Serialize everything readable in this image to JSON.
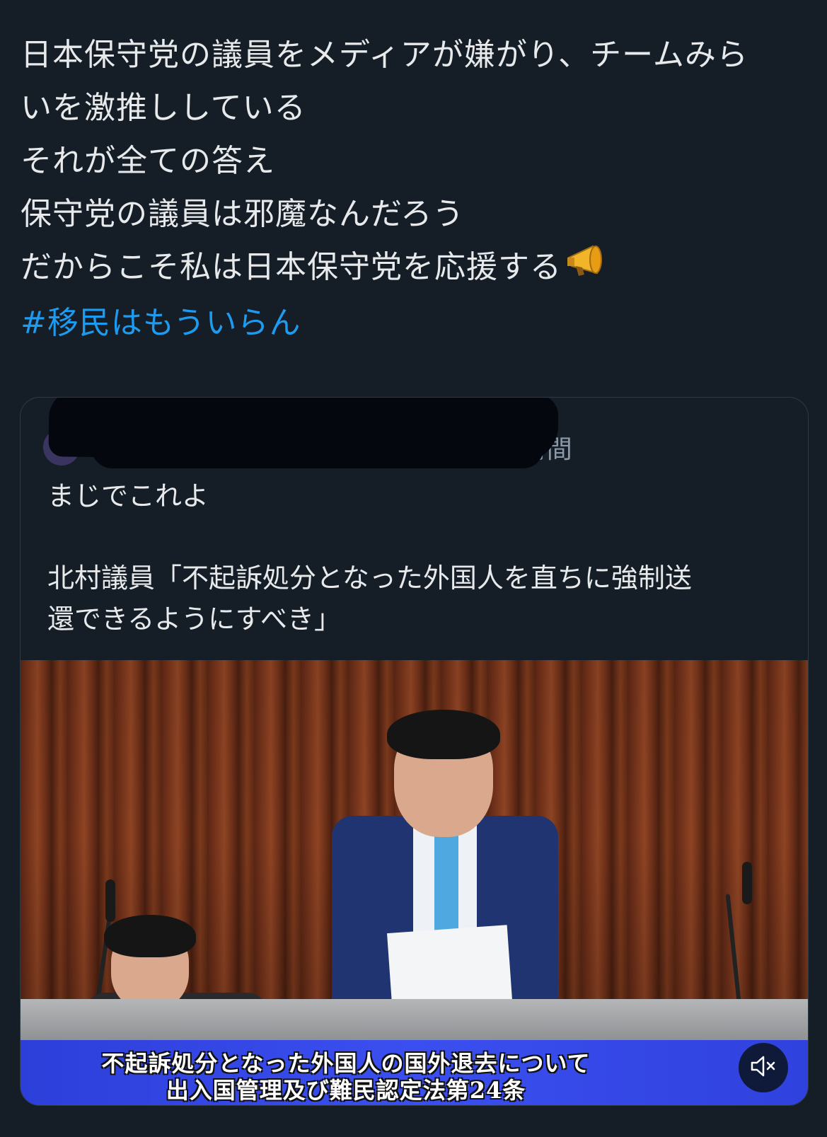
{
  "post": {
    "lines": [
      "日本保守党の議員をメディアが嫌がり、チームみら",
      "いを激推ししている",
      "それが全ての答え",
      "保守党の議員は邪魔なんだろう",
      "だからこそ私は日本保守党を応援する"
    ],
    "emoji": "megaphone-icon",
    "hashtag": "#移民はもういらん"
  },
  "quote": {
    "time": "21時間",
    "body_line1": "まじでこれよ",
    "body_line2": "北村議員「不起訴処分となった外国人を直ちに強制送",
    "body_line3": "還できるようにすべき」",
    "video": {
      "caption_line1": "不起訴処分となった外国人の国外退去について",
      "caption_line2": "出入国管理及び難民認定法第24条",
      "mute_icon": "mute-icon"
    }
  },
  "colors": {
    "background": "#151d27",
    "text": "#e7e9ea",
    "hashtag": "#1d9bf0",
    "caption_bar": "#3b4ff0"
  }
}
